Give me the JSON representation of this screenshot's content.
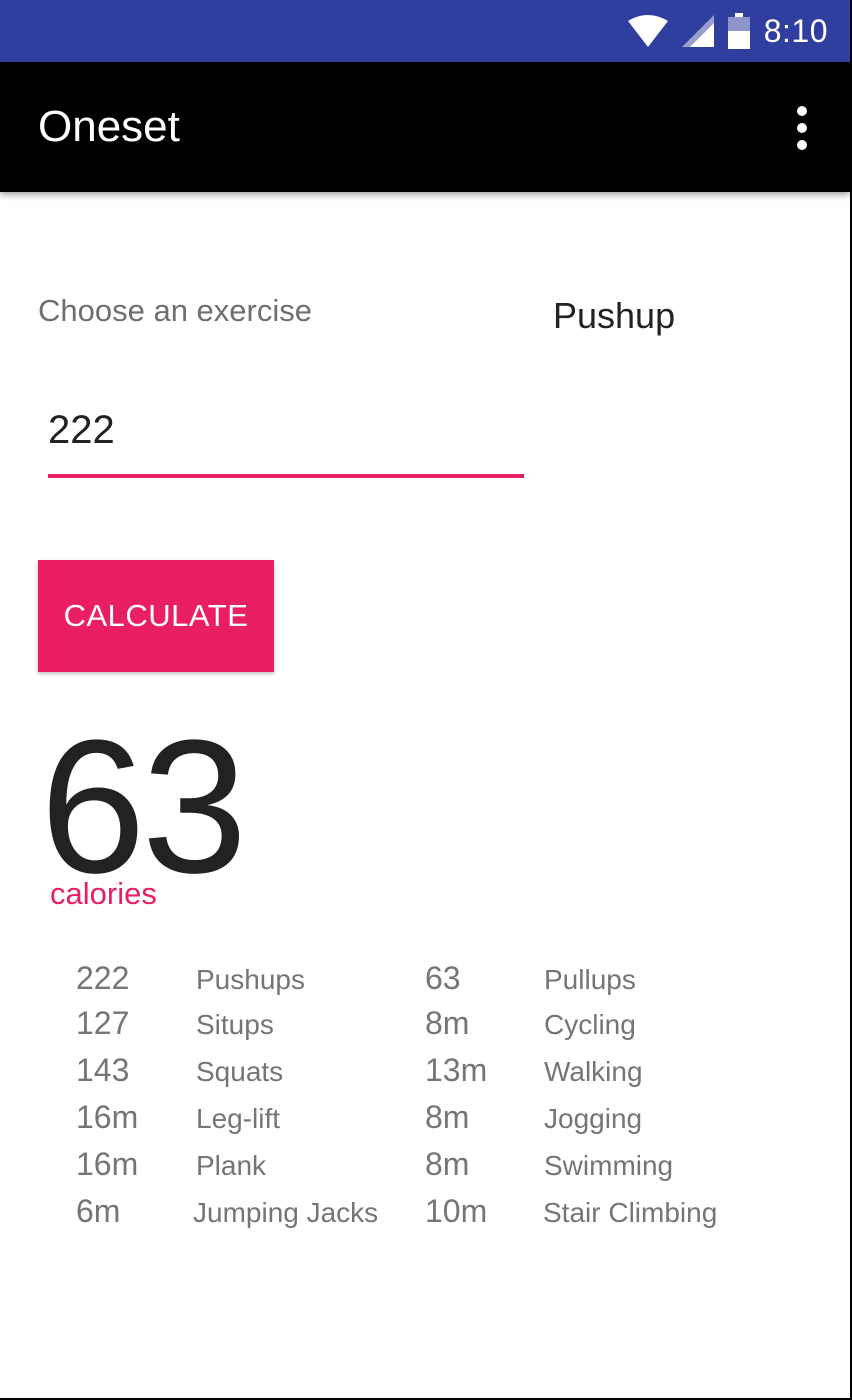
{
  "status_bar": {
    "time": "8:10",
    "icons": [
      "wifi-icon",
      "cell-signal-icon",
      "battery-icon"
    ],
    "background": "#303f9f"
  },
  "app_bar": {
    "title": "Oneset",
    "menu_icon": "overflow-menu-icon",
    "background": "#000000"
  },
  "form": {
    "choose_label": "Choose an exercise",
    "selected_exercise": "Pushup",
    "reps_value": "222",
    "calculate_label": "CALCULATE",
    "accent": "#e91e63"
  },
  "result": {
    "value": "63",
    "unit_label": "calories"
  },
  "stats": {
    "left": [
      {
        "value": "222",
        "label": "Pushups"
      },
      {
        "value": "127",
        "label": "Situps"
      },
      {
        "value": "143",
        "label": "Squats"
      },
      {
        "value": "16m",
        "label": "Leg-lift"
      },
      {
        "value": "16m",
        "label": "Plank"
      },
      {
        "value": "6m",
        "label": "Jumping Jacks"
      }
    ],
    "right": [
      {
        "value": "63",
        "label": "Pullups"
      },
      {
        "value": "8m",
        "label": "Cycling"
      },
      {
        "value": "13m",
        "label": "Walking"
      },
      {
        "value": "8m",
        "label": "Jogging"
      },
      {
        "value": "8m",
        "label": "Swimming"
      },
      {
        "value": "10m",
        "label": "Stair Climbing"
      }
    ]
  }
}
